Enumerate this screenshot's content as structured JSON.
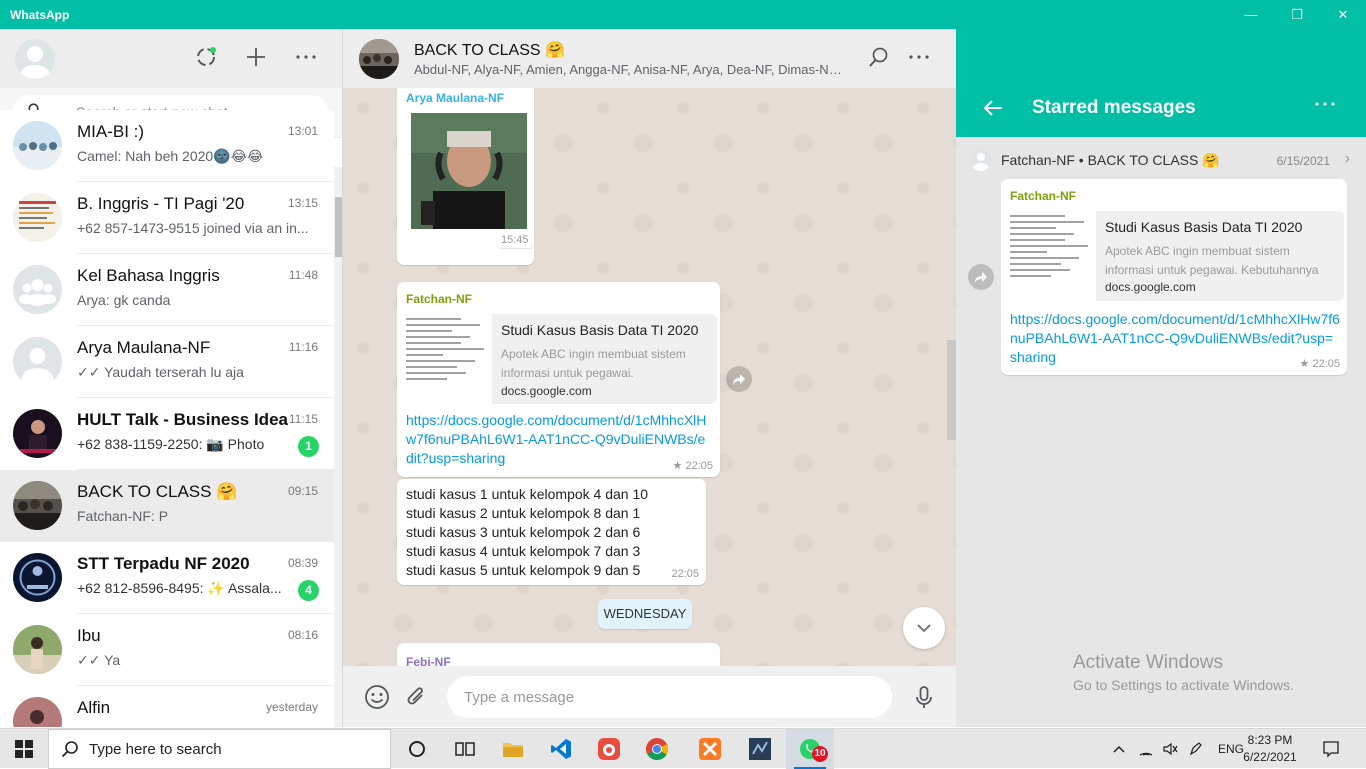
{
  "window": {
    "title": "WhatsApp",
    "minimize": "—",
    "maximize": "❐",
    "close": "✕"
  },
  "left": {
    "search_placeholder": "Search or start new chat",
    "chats": [
      {
        "name": "MIA-BI :)",
        "time": "13:01",
        "preview": "Camel: Nah beh 2020🌚😂😂",
        "bold": false,
        "badge": ""
      },
      {
        "name": "B. Inggris - TI Pagi '20",
        "time": "13:15",
        "preview": "+62 857-1473-9515 joined via an in...",
        "bold": false,
        "badge": ""
      },
      {
        "name": "Kel Bahasa Inggris",
        "time": "11:48",
        "preview": "Arya: gk canda",
        "bold": false,
        "badge": ""
      },
      {
        "name": "Arya Maulana-NF",
        "time": "11:16",
        "preview": "✓✓ Yaudah terserah lu aja",
        "bold": false,
        "badge": ""
      },
      {
        "name": "HULT Talk - Business Idea",
        "time": "11:15",
        "preview": "+62 838-1159-2250: 📷 Photo",
        "bold": true,
        "badge": "1"
      },
      {
        "name": "BACK TO CLASS 🤗",
        "time": "09:15",
        "preview": "Fatchan-NF: P",
        "bold": false,
        "badge": ""
      },
      {
        "name": "STT Terpadu NF 2020",
        "time": "08:39",
        "preview": "+62 812-8596-8495: ✨ Assala...",
        "bold": true,
        "badge": "4"
      },
      {
        "name": "Ibu",
        "time": "08:16",
        "preview": "✓✓ Ya",
        "bold": false,
        "badge": ""
      },
      {
        "name": "Alfin",
        "time": "yesterday",
        "preview": "",
        "bold": false,
        "badge": ""
      }
    ]
  },
  "conversation": {
    "group_name": "BACK TO CLASS 🤗",
    "members": "Abdul-NF, Alya-NF, Amien, Angga-NF, Anisa-NF, Arya, Dea-NF, Dimas-NF, Fatchan-NF, Febi-NF",
    "messages": {
      "m1": {
        "sender": "Arya Maulana-NF",
        "time": "15:45"
      },
      "m2": {
        "sender": "Fatchan-NF",
        "preview_title": "Studi Kasus Basis Data TI 2020",
        "preview_desc": "Apotek ABC ingin membuat sistem informasi untuk pegawai.",
        "preview_domain": "docs.google.com",
        "link": "https://docs.google.com/document/d/1cMhhcXlHw7f6nuPBAhL6W1-AAT1nCC-Q9vDuliENWBs/edit?usp=sharing",
        "time": "22:05"
      },
      "m3": {
        "lines": [
          "studi kasus 1 untuk kelompok 4 dan 10",
          "studi kasus 2 untuk kelompok 8 dan 1",
          "studi kasus 3 untuk kelompok 2 dan 6",
          "studi kasus 4 untuk kelompok 7 dan 3",
          "studi kasus 5 untuk kelompok 9 dan 5"
        ],
        "time": "22:05"
      },
      "day": "WEDNESDAY",
      "m4": {
        "sender": "Febi-NF"
      }
    },
    "compose_placeholder": "Type a message"
  },
  "starred": {
    "title": "Starred messages",
    "from": "Fatchan-NF • BACK TO CLASS 🤗",
    "date": "6/15/2021",
    "sender": "Fatchan-NF",
    "preview_title": "Studi Kasus Basis Data TI 2020",
    "preview_desc": "Apotek ABC ingin membuat sistem informasi untuk pegawai. Kebutuhannya",
    "preview_domain": "docs.google.com",
    "link": "https://docs.google.com/document/d/1cMhhcXlHw7f6nuPBAhL6W1-AAT1nCC-Q9vDuliENWBs/edit?usp=sharing",
    "time": "22:05"
  },
  "watermark": {
    "line1": "Activate Windows",
    "line2": "Go to Settings to activate Windows."
  },
  "taskbar": {
    "search_placeholder": "Type here to search",
    "lang": "ENG",
    "time": "8:23 PM",
    "date": "6/22/2021",
    "whatsapp_badge": "10"
  },
  "colors": {
    "accent": "#00bfa5",
    "sender_fatchan": "#7ba20d",
    "sender_arya": "#35b0e8",
    "sender_febi": "#8a6fd6",
    "link": "#039be5",
    "unread": "#25d366"
  }
}
